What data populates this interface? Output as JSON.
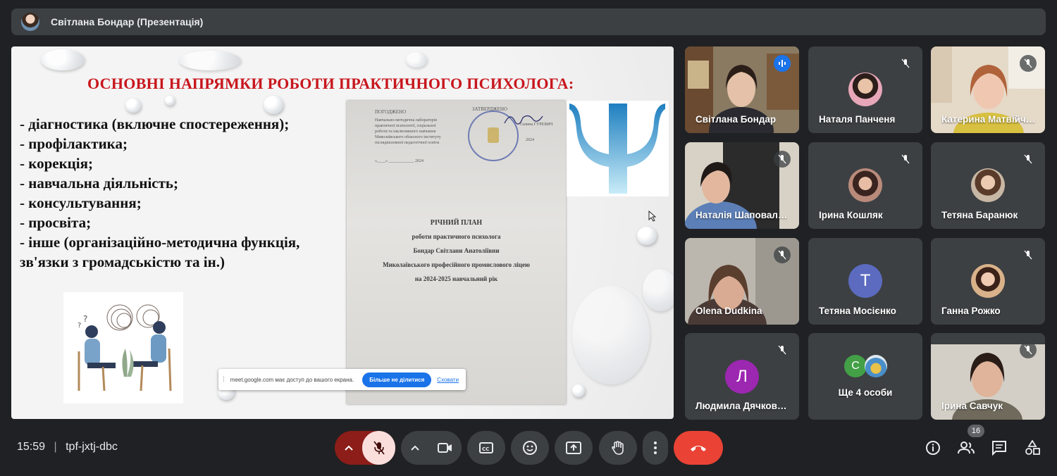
{
  "window": {
    "title": "Світлана Бондар (Презентація)"
  },
  "slide": {
    "title": "ОСНОВНІ НАПРЯМКИ РОБОТИ ПРАКТИЧНОГО ПСИХОЛОГА:",
    "bullets": [
      "-   діагностика (включне спостереження);",
      "-   профілактика;",
      "-   корекція;",
      "-   навчальна діяльність;",
      "-   консультування;",
      "-   просвіта;",
      "-   інше (організаційно-методична функція,",
      "зв'язки з громадськістю та ін.)"
    ],
    "document": {
      "left_header": "ПОГОДЖЕНО",
      "left_lines": [
        "Навчально-методична лабораторія",
        "практичної психології, соціальної",
        "роботи та інклюзивного навчання",
        "Миколаївського обласного інституту",
        "післядипломної педагогічної освіти"
      ],
      "left_date": "«____» ____________ 2024",
      "right_header": "ЗАТВЕРДЖЕНО",
      "right_line": "Галина ГУРЕВИЧ",
      "right_date": "2024",
      "main_lines": [
        "РІЧНИЙ ПЛАН",
        "роботи практичного психолога",
        "Бондар Світлани Анатоліївни",
        "Миколаївського професійного промислового ліцею",
        "на 2024-2025 навчальний рік"
      ]
    },
    "share_bar": {
      "grip": "⁞",
      "text": "meet.google.com має доступ до вашого екрана.",
      "stop_button": "Більше не ділитися",
      "hide_link": "Сховати"
    }
  },
  "participants": [
    {
      "name": "Світлана Бондар",
      "type": "video",
      "active": true
    },
    {
      "name": "Наталя Панченя",
      "type": "photo",
      "color": "#e7a7b9"
    },
    {
      "name": "Катерина Матвійч…",
      "type": "video"
    },
    {
      "name": "Наталія Шаповал…",
      "type": "video"
    },
    {
      "name": "Ірина Кошляк",
      "type": "photo",
      "color": "#b98a7a"
    },
    {
      "name": "Тетяна Баранюк",
      "type": "photo",
      "color": "#c8b7a4"
    },
    {
      "name": "Olena Dudkina",
      "type": "video"
    },
    {
      "name": "Тетяна Мосієнко",
      "type": "letter",
      "letter": "Т",
      "color": "#5c6bc0"
    },
    {
      "name": "Ганна Рожко",
      "type": "photo",
      "color": "#d9b28a"
    },
    {
      "name": "Людмила Дячков…",
      "type": "letter",
      "letter": "Л",
      "color": "#9c27b0"
    },
    {
      "name": "Ще 4 особи",
      "type": "more",
      "letter": "С",
      "color": "#43a047"
    },
    {
      "name": "Ірина Савчук",
      "type": "video"
    }
  ],
  "bottom": {
    "time": "15:59",
    "separator": "|",
    "meeting_code": "tpf-jxtj-dbc",
    "participant_count": "16"
  },
  "colors": {
    "accent": "#8ab4f8",
    "mic_off_bg": "#f9dedc",
    "end_call": "#ea4335",
    "mic_arrow_bg": "#8c1d18"
  },
  "icons": [
    "mic-off-icon",
    "camera-icon",
    "captions-icon",
    "emoji-icon",
    "present-icon",
    "raise-hand-icon",
    "more-options-icon",
    "end-call-icon",
    "info-icon",
    "people-icon",
    "chat-icon",
    "activities-icon"
  ]
}
